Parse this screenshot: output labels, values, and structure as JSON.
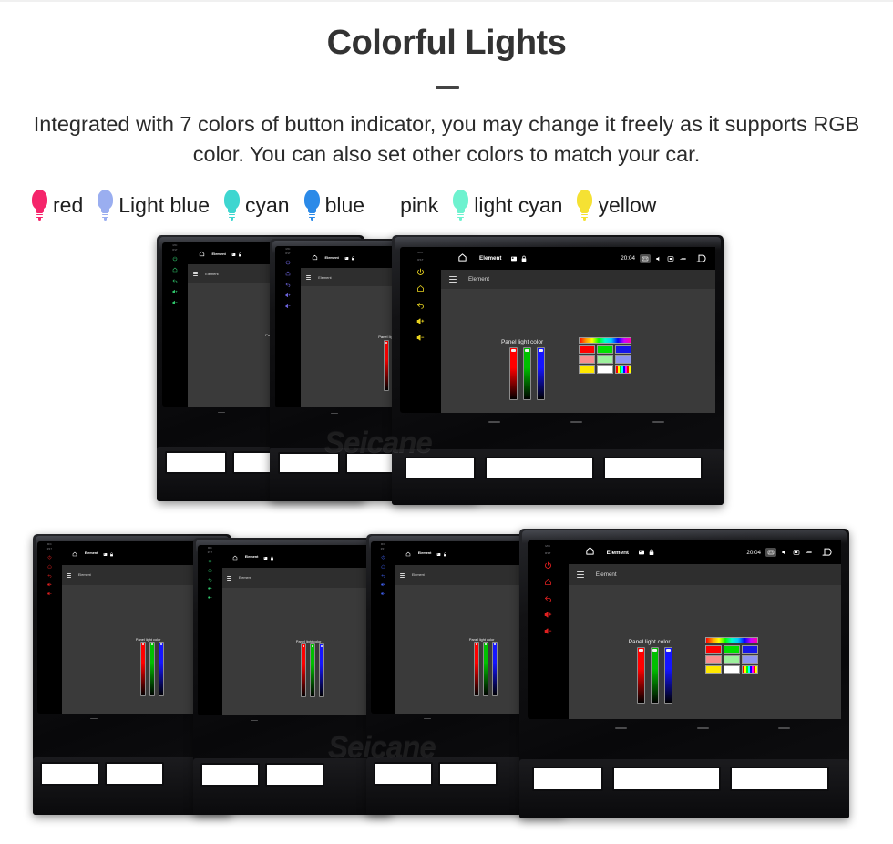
{
  "header": {
    "title": "Colorful Lights",
    "subtitle": "Integrated with 7 colors of button indicator, you may change it freely as it supports RGB color. You can also set other colors to match your car."
  },
  "legend": {
    "items": [
      {
        "label": "red",
        "color": "#f5256b"
      },
      {
        "label": "Light blue",
        "color": "#9aaef0"
      },
      {
        "label": "cyan",
        "color": "#3ed6d0"
      },
      {
        "label": "blue",
        "color": "#2b8ae8"
      },
      {
        "label": "pink",
        "color": "#f councilor"
      },
      {
        "label": "light cyan",
        "color": "#6ef2cf"
      },
      {
        "label": "yellow",
        "color": "#f5e133"
      }
    ]
  },
  "device": {
    "brand_watermark": "Seicane",
    "statusbar": {
      "title": "Element",
      "time": "20:04",
      "icons": [
        "home-icon",
        "sd-card-icon",
        "lock-icon",
        "screenshot-icon",
        "mute-icon",
        "window-icon",
        "eject-icon",
        "back-icon"
      ]
    },
    "appbar": {
      "title": "Element",
      "menu_icon": "hamburger-icon"
    },
    "settings": {
      "panel_label": "Panel light color",
      "sliders": [
        {
          "name": "red-slider",
          "color": "#ff0000"
        },
        {
          "name": "green-slider",
          "color": "#00c000"
        },
        {
          "name": "blue-slider",
          "color": "#1515ff"
        }
      ],
      "palette": {
        "gradient_bar": "rainbow-gradient",
        "rows": [
          [
            "#ff0000",
            "#00e000",
            "#1616e8"
          ],
          [
            "#f98e8e",
            "#9bf09b",
            "#8e95f0"
          ],
          [
            "#ffe800",
            "#ffffff",
            "rainbow-stripe"
          ]
        ]
      }
    },
    "rail": {
      "labels": [
        "MIC",
        "RST"
      ],
      "buttons": [
        "power-icon",
        "home-icon",
        "back-icon",
        "volume-up-icon",
        "volume-down-icon"
      ]
    }
  },
  "rows": [
    {
      "name": "top-row",
      "units": [
        {
          "rail_color": "#2fc46a"
        },
        {
          "rail_color": "#6a62d8"
        },
        {
          "rail_color": "#e8d21f"
        }
      ]
    },
    {
      "name": "bottom-row",
      "units": [
        {
          "rail_color": "#e02020"
        },
        {
          "rail_color": "#2fc46a"
        },
        {
          "rail_color": "#3d5ce8"
        },
        {
          "rail_color": "#e02020"
        }
      ]
    }
  ]
}
